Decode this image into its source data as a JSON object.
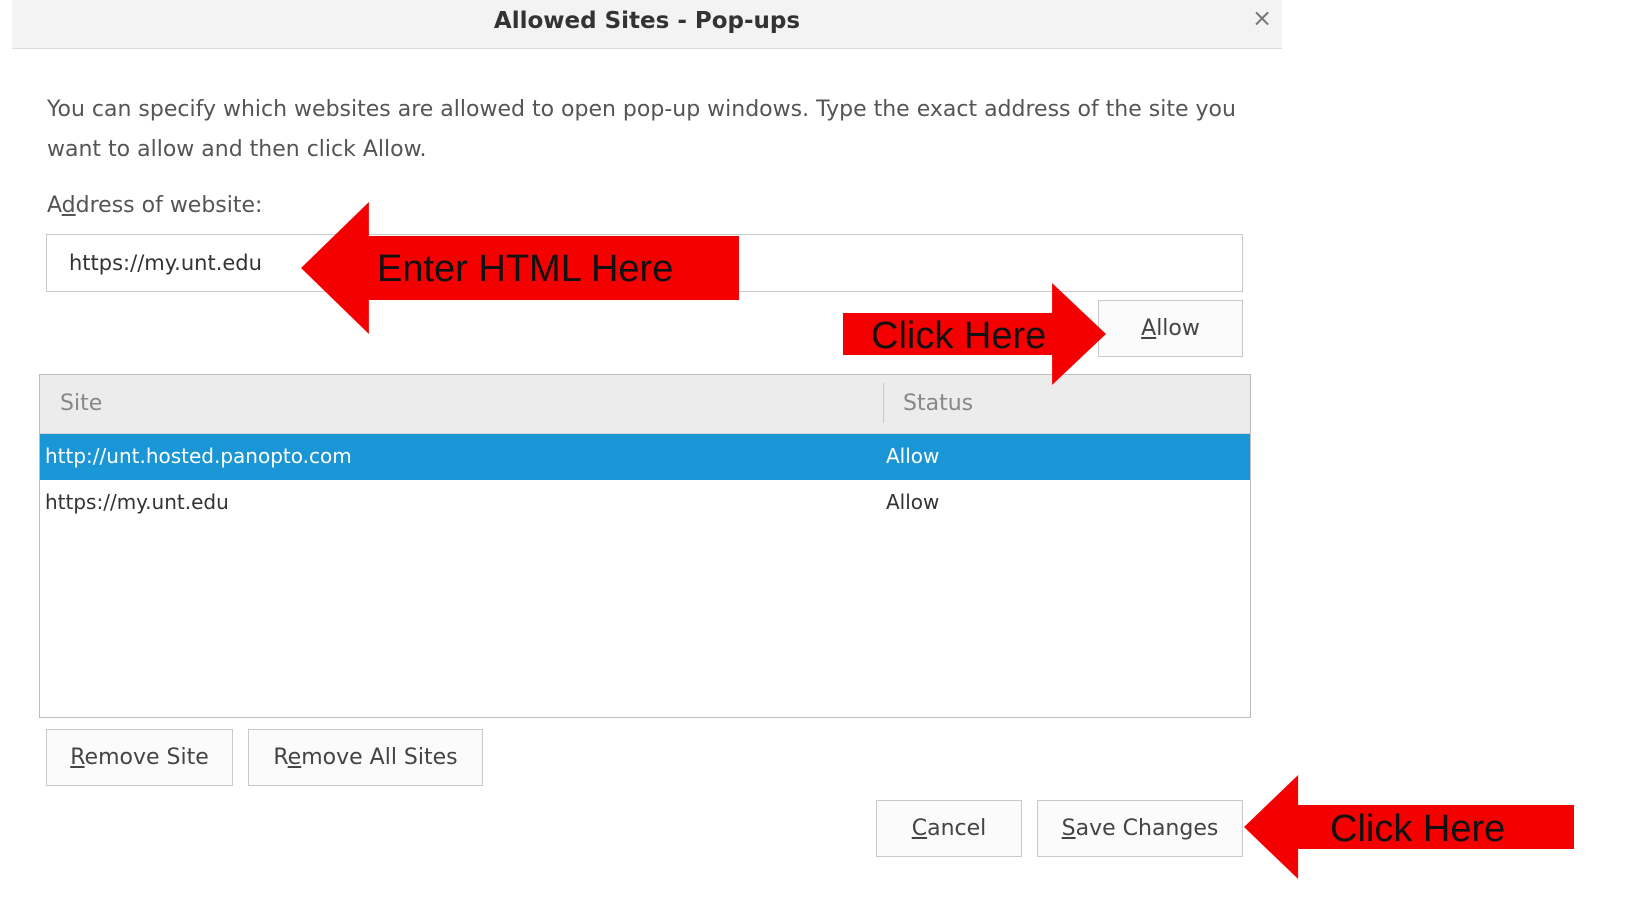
{
  "dialog": {
    "title": "Allowed Sites - Pop-ups",
    "close_symbol": "×",
    "description": "You can specify which websites are allowed to open pop-up windows. Type the exact address of the site you want to allow and then click Allow.",
    "address_label": "Address of website:",
    "address_value": "https://my.unt.edu",
    "allow_label": "Allow"
  },
  "table": {
    "columns": [
      "Site",
      "Status"
    ],
    "rows": [
      {
        "site": "http://unt.hosted.panopto.com",
        "status": "Allow",
        "selected": true
      },
      {
        "site": "https://my.unt.edu",
        "status": "Allow",
        "selected": false
      }
    ]
  },
  "buttons": {
    "remove_site": "Remove Site",
    "remove_all_sites": "Remove All Sites",
    "cancel": "Cancel",
    "save_changes": "Save Changes"
  },
  "annotations": {
    "enter_label": "Enter HTML Here",
    "click_allow_label": "Click Here",
    "click_save_label": "Click Here"
  },
  "colors": {
    "selection": "#1a95d6",
    "annotation_arrow": "#f40000"
  },
  "icons": [
    "close-icon",
    "red-arrow-left",
    "red-arrow-right"
  ]
}
